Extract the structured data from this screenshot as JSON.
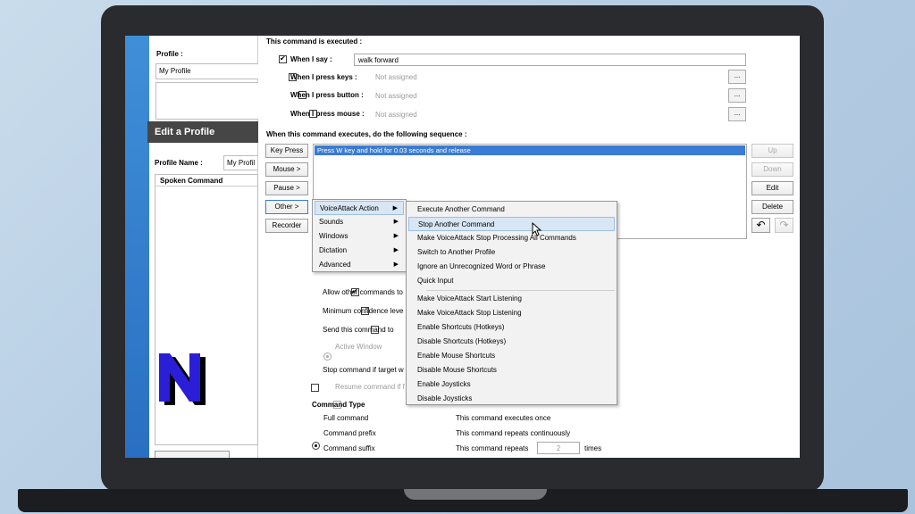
{
  "profile": {
    "label": "Profile :",
    "selected": "My Profile"
  },
  "edit_profile": {
    "title": "Edit a Profile",
    "name_label": "Profile Name :",
    "name_value": "My Profil",
    "list_header": "Spoken Command"
  },
  "command": {
    "executed_heading": "This command is executed :",
    "when_i_say_label": "When I say :",
    "when_i_say_value": "walk forward",
    "when_keys_label": "When I press keys :",
    "when_button_label": "When I press button :",
    "when_mouse_label": "When I press mouse :",
    "not_assigned": "Not assigned",
    "browse_label": "...",
    "sequence_heading": "When this command executes, do the following sequence :",
    "actions": [
      "Press W key and hold for 0.03 seconds and release"
    ]
  },
  "left_buttons": {
    "key_press": "Key Press",
    "mouse": "Mouse >",
    "pause": "Pause >",
    "other": "Other >",
    "recorder": "Recorder"
  },
  "right_buttons": {
    "up": "Up",
    "down": "Down",
    "edit": "Edit",
    "delete": "Delete",
    "undo_icon": "↶",
    "redo_icon": "↷"
  },
  "options": {
    "allow_other": "Allow other commands to",
    "min_confidence": "Minimum confidence leve",
    "send_command": "Send this command to",
    "active_window": "Active Window",
    "stop_if_target": "Stop command if target w",
    "resume_if": "Resume command if f"
  },
  "command_type": {
    "heading": "Command Type",
    "full": "Full command",
    "prefix": "Command prefix",
    "suffix": "Command suffix"
  },
  "repeating": {
    "once": "This command executes once",
    "continuous": "This command repeats continuously",
    "repeats": "This command repeats",
    "count": "2",
    "times": "times"
  },
  "other_menu": {
    "items": [
      "VoiceAttack Action",
      "Sounds",
      "Windows",
      "Dictation",
      "Advanced"
    ]
  },
  "voiceattack_submenu": {
    "group1": [
      "Execute Another Command",
      "Stop Another Command",
      "Make VoiceAttack Stop Processing All Commands",
      "Switch to Another Profile",
      "Ignore an Unrecognized Word or Phrase",
      "Quick Input"
    ],
    "group2": [
      "Make VoiceAttack Start Listening",
      "Make VoiceAttack Stop Listening",
      "Enable Shortcuts (Hotkeys)",
      "Disable Shortcuts (Hotkeys)",
      "Enable Mouse Shortcuts",
      "Disable Mouse Shortcuts",
      "Enable Joysticks",
      "Disable Joysticks"
    ]
  },
  "colors": {
    "selection": "#3a7bd5",
    "menu_highlight": "#d8e6f5",
    "logo_blue": "#2a1fd6"
  }
}
